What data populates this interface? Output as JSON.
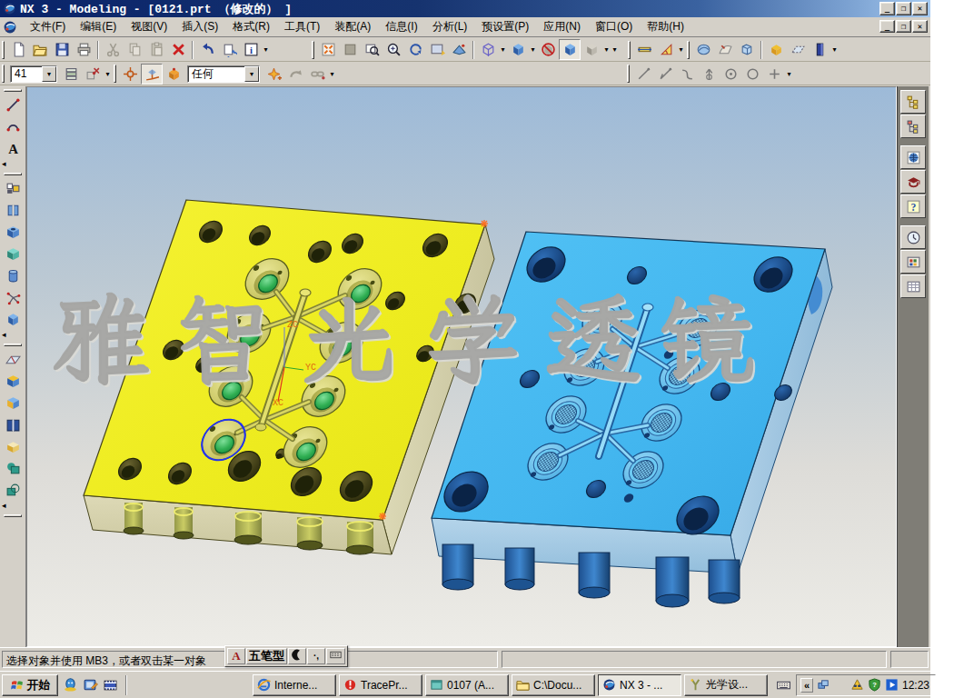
{
  "window": {
    "title": "NX 3 - Modeling - [0121.prt （修改的） ]",
    "controls": {
      "minimize": "_",
      "restore": "❐",
      "close": "✕"
    }
  },
  "menu_bar": {
    "items": [
      "文件(F)",
      "编辑(E)",
      "视图(V)",
      "插入(S)",
      "格式(R)",
      "工具(T)",
      "装配(A)",
      "信息(I)",
      "分析(L)",
      "预设置(P)",
      "应用(N)",
      "窗口(O)",
      "帮助(H)"
    ]
  },
  "toolbars": {
    "layer_value": "41",
    "selection_filter_value": "任何"
  },
  "viewport": {
    "watermark_text": "雅智光学透镜",
    "axis_labels": {
      "zc": "ZC",
      "yc": "YC",
      "xc": "XC"
    }
  },
  "status_bar": {
    "message": "选择对象并使用 MB3，或者双击某一对象"
  },
  "ime_bar": {
    "lang": "A",
    "input_method": "五笔型",
    "punctuation": "·,"
  },
  "glyphs": {
    "dropdown_arrow": "▾",
    "collapse_arrow": "◂"
  },
  "taskbar": {
    "start_label": "开始",
    "tray_chevron": "«",
    "tasks": [
      {
        "label": "Interne...",
        "icon": "internet-explorer-icon",
        "active": false
      },
      {
        "label": "TracePr...",
        "icon": "tracepro-icon",
        "active": false
      },
      {
        "label": "0107 (A...",
        "icon": "document-window-icon",
        "active": false
      },
      {
        "label": "C:\\Docu...",
        "icon": "folder-icon",
        "active": false
      },
      {
        "label": "NX 3 - ...",
        "icon": "nx-icon",
        "active": true
      },
      {
        "label": "光学设...",
        "icon": "optics-app-icon",
        "active": false
      }
    ],
    "clock": "12:23"
  }
}
